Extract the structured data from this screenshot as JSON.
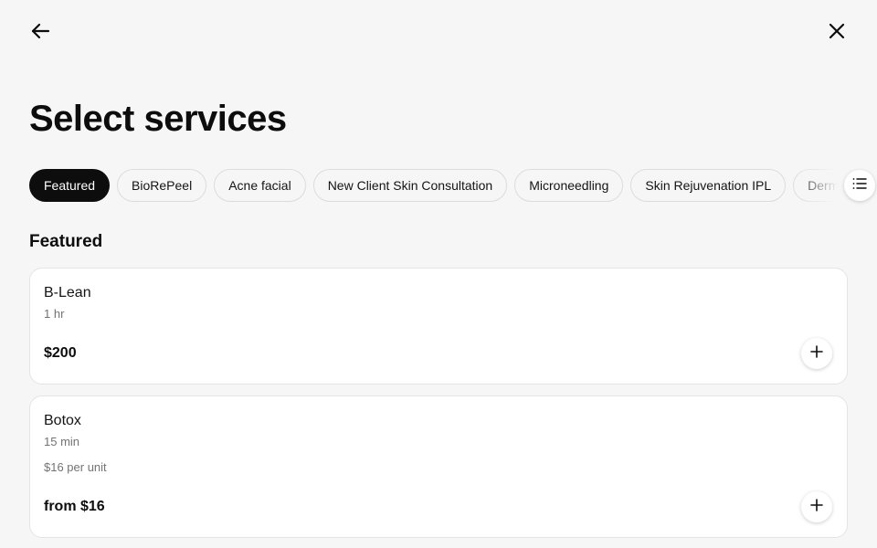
{
  "header": {
    "back_icon": "arrow-left-icon",
    "close_icon": "close-icon",
    "title": "Select services"
  },
  "categories": {
    "items": [
      {
        "label": "Featured",
        "active": true
      },
      {
        "label": "BioRePeel",
        "active": false
      },
      {
        "label": "Acne facial",
        "active": false
      },
      {
        "label": "New Client Skin Consultation",
        "active": false
      },
      {
        "label": "Microneedling",
        "active": false
      },
      {
        "label": "Skin Rejuvenation IPL",
        "active": false
      },
      {
        "label": "Derma",
        "active": false
      }
    ],
    "list_icon": "list-icon"
  },
  "section": {
    "title": "Featured"
  },
  "services": [
    {
      "name": "B-Lean",
      "duration": "1 hr",
      "price": "$200",
      "add_icon": "plus-icon"
    },
    {
      "name": "Botox",
      "duration": "15 min",
      "note": "$16 per unit",
      "price": "from $16",
      "add_icon": "plus-icon"
    }
  ],
  "colors": {
    "background": "#f6f6f6",
    "card": "#ffffff",
    "active_chip": "#0d0d0d",
    "text_primary": "#0d0d0d",
    "text_secondary": "#737373",
    "border": "#dcdcdc"
  }
}
